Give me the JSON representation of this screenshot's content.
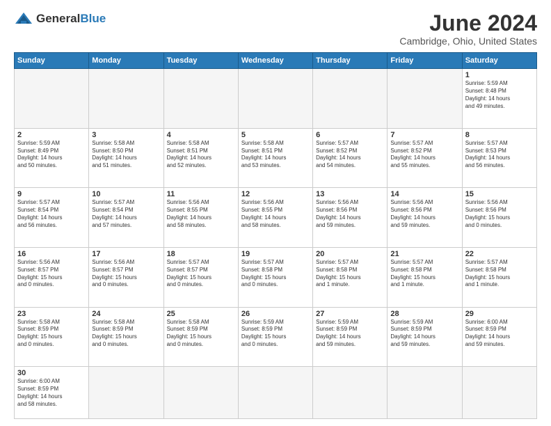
{
  "logo": {
    "text_general": "General",
    "text_blue": "Blue"
  },
  "header": {
    "month": "June 2024",
    "location": "Cambridge, Ohio, United States"
  },
  "weekdays": [
    "Sunday",
    "Monday",
    "Tuesday",
    "Wednesday",
    "Thursday",
    "Friday",
    "Saturday"
  ],
  "weeks": [
    [
      {
        "day": "",
        "info": ""
      },
      {
        "day": "",
        "info": ""
      },
      {
        "day": "",
        "info": ""
      },
      {
        "day": "",
        "info": ""
      },
      {
        "day": "",
        "info": ""
      },
      {
        "day": "",
        "info": ""
      },
      {
        "day": "1",
        "info": "Sunrise: 5:59 AM\nSunset: 8:48 PM\nDaylight: 14 hours\nand 49 minutes."
      }
    ],
    [
      {
        "day": "2",
        "info": "Sunrise: 5:59 AM\nSunset: 8:49 PM\nDaylight: 14 hours\nand 50 minutes."
      },
      {
        "day": "3",
        "info": "Sunrise: 5:58 AM\nSunset: 8:50 PM\nDaylight: 14 hours\nand 51 minutes."
      },
      {
        "day": "4",
        "info": "Sunrise: 5:58 AM\nSunset: 8:51 PM\nDaylight: 14 hours\nand 52 minutes."
      },
      {
        "day": "5",
        "info": "Sunrise: 5:58 AM\nSunset: 8:51 PM\nDaylight: 14 hours\nand 53 minutes."
      },
      {
        "day": "6",
        "info": "Sunrise: 5:57 AM\nSunset: 8:52 PM\nDaylight: 14 hours\nand 54 minutes."
      },
      {
        "day": "7",
        "info": "Sunrise: 5:57 AM\nSunset: 8:52 PM\nDaylight: 14 hours\nand 55 minutes."
      },
      {
        "day": "8",
        "info": "Sunrise: 5:57 AM\nSunset: 8:53 PM\nDaylight: 14 hours\nand 56 minutes."
      }
    ],
    [
      {
        "day": "9",
        "info": "Sunrise: 5:57 AM\nSunset: 8:54 PM\nDaylight: 14 hours\nand 56 minutes."
      },
      {
        "day": "10",
        "info": "Sunrise: 5:57 AM\nSunset: 8:54 PM\nDaylight: 14 hours\nand 57 minutes."
      },
      {
        "day": "11",
        "info": "Sunrise: 5:56 AM\nSunset: 8:55 PM\nDaylight: 14 hours\nand 58 minutes."
      },
      {
        "day": "12",
        "info": "Sunrise: 5:56 AM\nSunset: 8:55 PM\nDaylight: 14 hours\nand 58 minutes."
      },
      {
        "day": "13",
        "info": "Sunrise: 5:56 AM\nSunset: 8:56 PM\nDaylight: 14 hours\nand 59 minutes."
      },
      {
        "day": "14",
        "info": "Sunrise: 5:56 AM\nSunset: 8:56 PM\nDaylight: 14 hours\nand 59 minutes."
      },
      {
        "day": "15",
        "info": "Sunrise: 5:56 AM\nSunset: 8:56 PM\nDaylight: 15 hours\nand 0 minutes."
      }
    ],
    [
      {
        "day": "16",
        "info": "Sunrise: 5:56 AM\nSunset: 8:57 PM\nDaylight: 15 hours\nand 0 minutes."
      },
      {
        "day": "17",
        "info": "Sunrise: 5:56 AM\nSunset: 8:57 PM\nDaylight: 15 hours\nand 0 minutes."
      },
      {
        "day": "18",
        "info": "Sunrise: 5:57 AM\nSunset: 8:57 PM\nDaylight: 15 hours\nand 0 minutes."
      },
      {
        "day": "19",
        "info": "Sunrise: 5:57 AM\nSunset: 8:58 PM\nDaylight: 15 hours\nand 0 minutes."
      },
      {
        "day": "20",
        "info": "Sunrise: 5:57 AM\nSunset: 8:58 PM\nDaylight: 15 hours\nand 1 minute."
      },
      {
        "day": "21",
        "info": "Sunrise: 5:57 AM\nSunset: 8:58 PM\nDaylight: 15 hours\nand 1 minute."
      },
      {
        "day": "22",
        "info": "Sunrise: 5:57 AM\nSunset: 8:58 PM\nDaylight: 15 hours\nand 1 minute."
      }
    ],
    [
      {
        "day": "23",
        "info": "Sunrise: 5:58 AM\nSunset: 8:59 PM\nDaylight: 15 hours\nand 0 minutes."
      },
      {
        "day": "24",
        "info": "Sunrise: 5:58 AM\nSunset: 8:59 PM\nDaylight: 15 hours\nand 0 minutes."
      },
      {
        "day": "25",
        "info": "Sunrise: 5:58 AM\nSunset: 8:59 PM\nDaylight: 15 hours\nand 0 minutes."
      },
      {
        "day": "26",
        "info": "Sunrise: 5:59 AM\nSunset: 8:59 PM\nDaylight: 15 hours\nand 0 minutes."
      },
      {
        "day": "27",
        "info": "Sunrise: 5:59 AM\nSunset: 8:59 PM\nDaylight: 14 hours\nand 59 minutes."
      },
      {
        "day": "28",
        "info": "Sunrise: 5:59 AM\nSunset: 8:59 PM\nDaylight: 14 hours\nand 59 minutes."
      },
      {
        "day": "29",
        "info": "Sunrise: 6:00 AM\nSunset: 8:59 PM\nDaylight: 14 hours\nand 59 minutes."
      }
    ],
    [
      {
        "day": "30",
        "info": "Sunrise: 6:00 AM\nSunset: 8:59 PM\nDaylight: 14 hours\nand 58 minutes."
      },
      {
        "day": "",
        "info": ""
      },
      {
        "day": "",
        "info": ""
      },
      {
        "day": "",
        "info": ""
      },
      {
        "day": "",
        "info": ""
      },
      {
        "day": "",
        "info": ""
      },
      {
        "day": "",
        "info": ""
      }
    ]
  ]
}
